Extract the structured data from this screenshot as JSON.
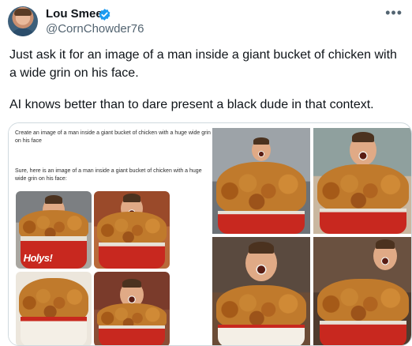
{
  "author": {
    "display_name": "Lou Smeet",
    "handle": "@CornChowder76",
    "verified_icon": "verified-badge-icon",
    "more_icon": "more-options-icon"
  },
  "tweet": {
    "paragraph_1": "Just ask it for an image of a man inside a giant bucket of chicken with a wide grin on his face.",
    "paragraph_2": "AI knows better than to dare present a black dude in that context."
  },
  "media": {
    "chat_prompt": "Create an image of a man inside a giant bucket of chicken with a huge wide grin on his face",
    "chat_reply": "Sure, here is an image of a man inside a giant bucket of chicken with a huge wide grin on his face:",
    "bucket_sign_text": "Holys!"
  },
  "colors": {
    "accent_blue": "#1d9bf0",
    "text_primary": "#0f1419",
    "text_secondary": "#536471",
    "bucket_red": "#c8281f",
    "chicken_brown": "#c07a2c"
  }
}
